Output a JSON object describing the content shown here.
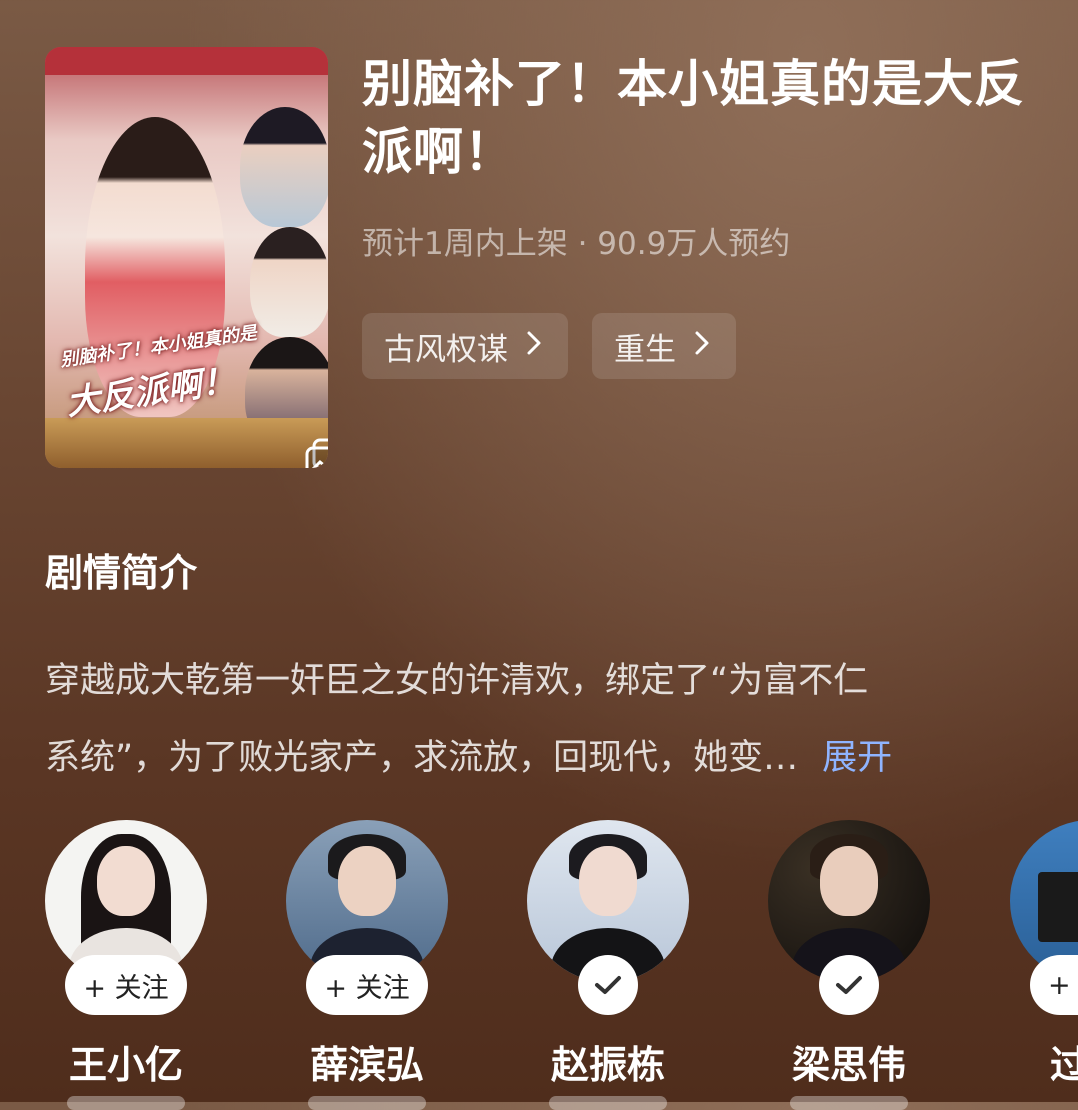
{
  "drama": {
    "title": "别脑补了！本小姐真的是大反派啊！",
    "cover_title_line1": "别脑补了！本小姐真的是",
    "cover_title_line2": "大反派啊！",
    "subtitle": "预计1周内上架 · 90.9万人预约",
    "tags": [
      {
        "label": "古风权谋",
        "icon": "chevron-right-icon"
      },
      {
        "label": "重生",
        "icon": "chevron-right-icon"
      }
    ]
  },
  "synopsis": {
    "heading": "剧情简介",
    "line1": "穿越成大乾第一奸臣之女的许清欢，绑定了“为富不仁",
    "line2": "系统”，为了败光家产，求流放，回现代，她变…",
    "expand_label": "展开"
  },
  "cast": [
    {
      "name": "王小亿",
      "follow_state": "follow",
      "follow_label": "+ 关注"
    },
    {
      "name": "薛滨弘",
      "follow_state": "follow",
      "follow_label": "+ 关注"
    },
    {
      "name": "赵振栋",
      "follow_state": "followed",
      "icon": "checkmark-icon"
    },
    {
      "name": "梁思伟",
      "follow_state": "followed",
      "icon": "checkmark-icon"
    },
    {
      "name": "过",
      "follow_state": "follow",
      "follow_label": "+"
    }
  ],
  "colors": {
    "background_top": "#7a5a45",
    "background_bottom": "#4f2d1c",
    "expand_link": "#8fb4ff",
    "cover_banner": "#b5313a"
  }
}
